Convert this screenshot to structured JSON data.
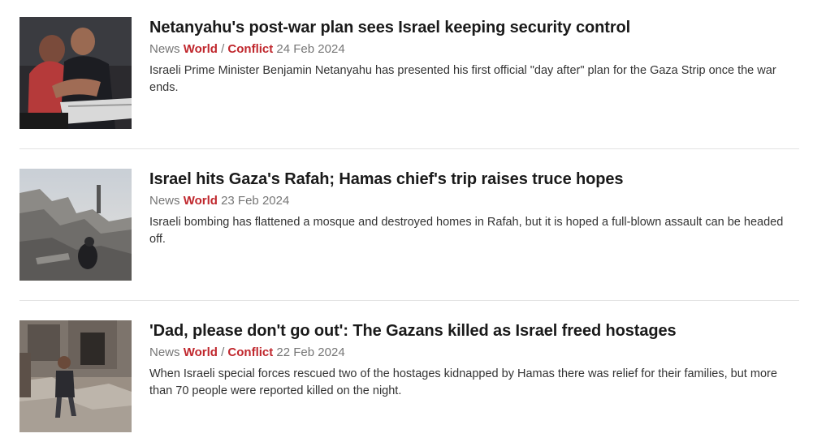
{
  "articles": [
    {
      "headline": "Netanyahu's post-war plan sees Israel keeping security control",
      "section": "News",
      "category1": "World",
      "separator": "/",
      "category2": "Conflict",
      "date": "24 Feb 2024",
      "summary": "Israeli Prime Minister Benjamin Netanyahu has presented his first official \"day after\" plan for the Gaza Strip once the war ends.",
      "image_alt": "Mourners grieving"
    },
    {
      "headline": "Israel hits Gaza's Rafah; Hamas chief's trip raises truce hopes",
      "section": "News",
      "category1": "World",
      "date": "23 Feb 2024",
      "summary": "Israeli bombing has flattened a mosque and destroyed homes in Rafah, but it is hoped a full-blown assault can be headed off.",
      "image_alt": "Rubble of destroyed buildings"
    },
    {
      "headline": "'Dad, please don't go out': The Gazans killed as Israel freed hostages",
      "section": "News",
      "category1": "World",
      "separator": "/",
      "category2": "Conflict",
      "date": "22 Feb 2024",
      "summary": "When Israeli special forces rescued two of the hostages kidnapped by Hamas there was relief for their families, but more than 70 people were reported killed on the night.",
      "image_alt": "Child walking through debris"
    }
  ],
  "colors": {
    "category": "#c0272d",
    "meta": "#767676",
    "headline": "#1a1a1a",
    "divider": "#e3e3e3"
  }
}
